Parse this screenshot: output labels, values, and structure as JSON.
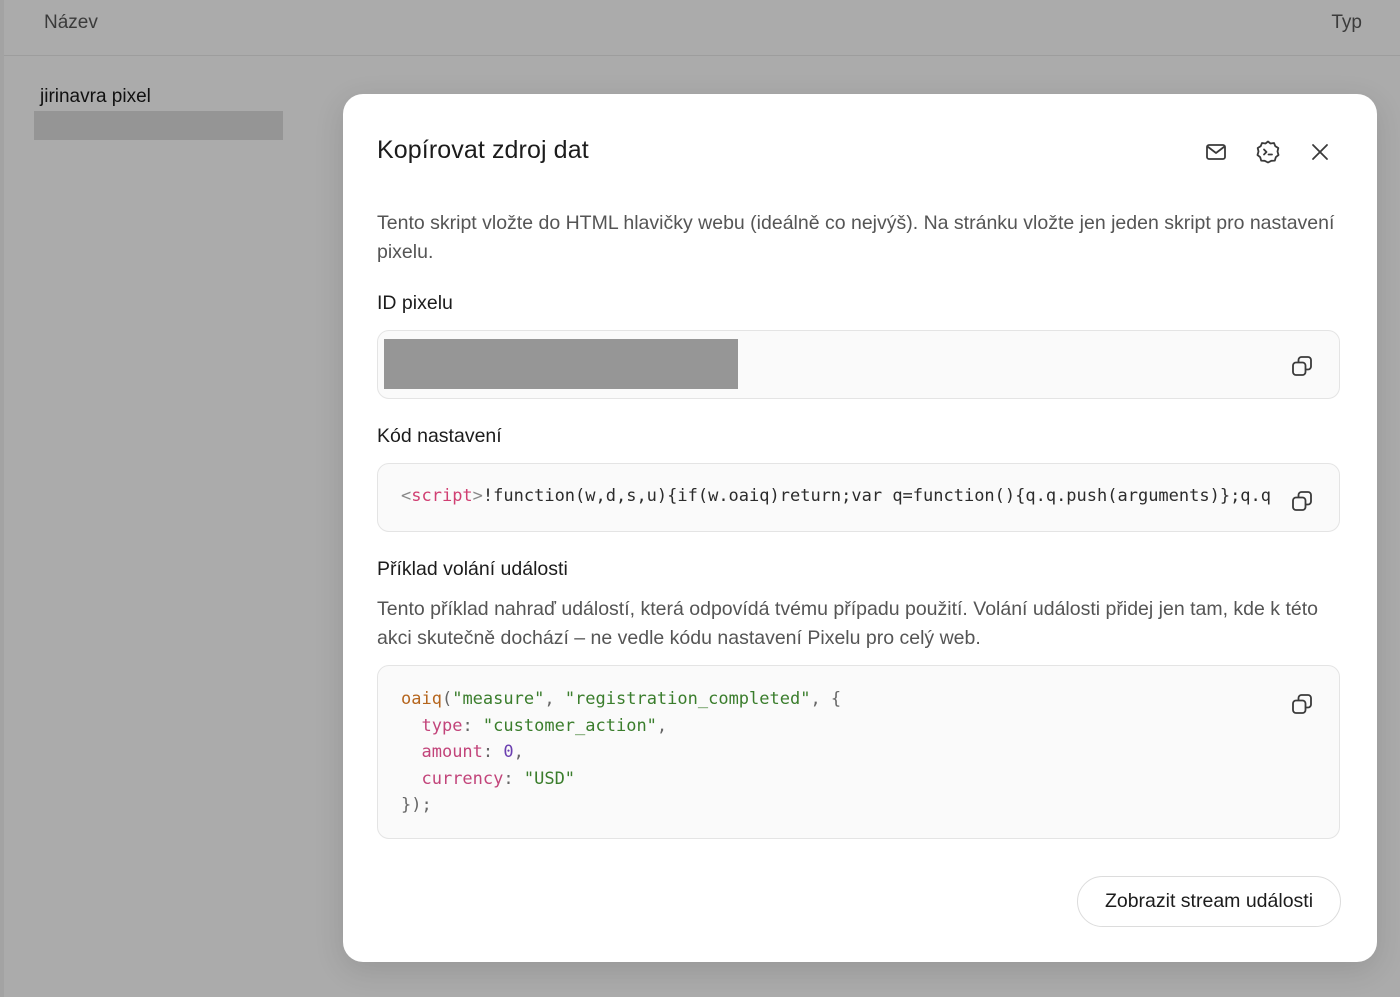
{
  "background": {
    "column_name": "Název",
    "column_type": "Typ",
    "row_name": "jirinavra pixel"
  },
  "modal": {
    "title": "Kopírovat zdroj dat",
    "header_icons": [
      "mail-icon",
      "bot-icon",
      "close-icon"
    ],
    "intro": "Tento skript vložte do HTML hlavičky webu (ideálně co nejvýš). Na stránku vložte jen jeden skript pro nastavení pixelu.",
    "pixel_id_label": "ID pixelu",
    "setup_code_label": "Kód nastavení",
    "setup_code": {
      "tag_open": "<",
      "tag_name": "script",
      "tag_close": ">",
      "body": "!function(w,d,s,u){if(w.oaiq)return;var q=function(){q.q.push(arguments)};q.q"
    },
    "event_label": "Příklad volání události",
    "event_description": "Tento příklad nahraď událostí, která odpovídá tvému případu použití. Volání události přidej jen tam, kde k této akci skutečně dochází – ne vedle kódu nastavení Pixelu pro celý web.",
    "example": {
      "fn": "oaiq",
      "arg1": "\"measure\"",
      "arg2": "\"registration_completed\"",
      "key1": "type",
      "val1": "\"customer_action\"",
      "key2": "amount",
      "val2": "0",
      "key3": "currency",
      "val3": "\"USD\""
    },
    "stream_button": "Zobrazit stream události"
  }
}
